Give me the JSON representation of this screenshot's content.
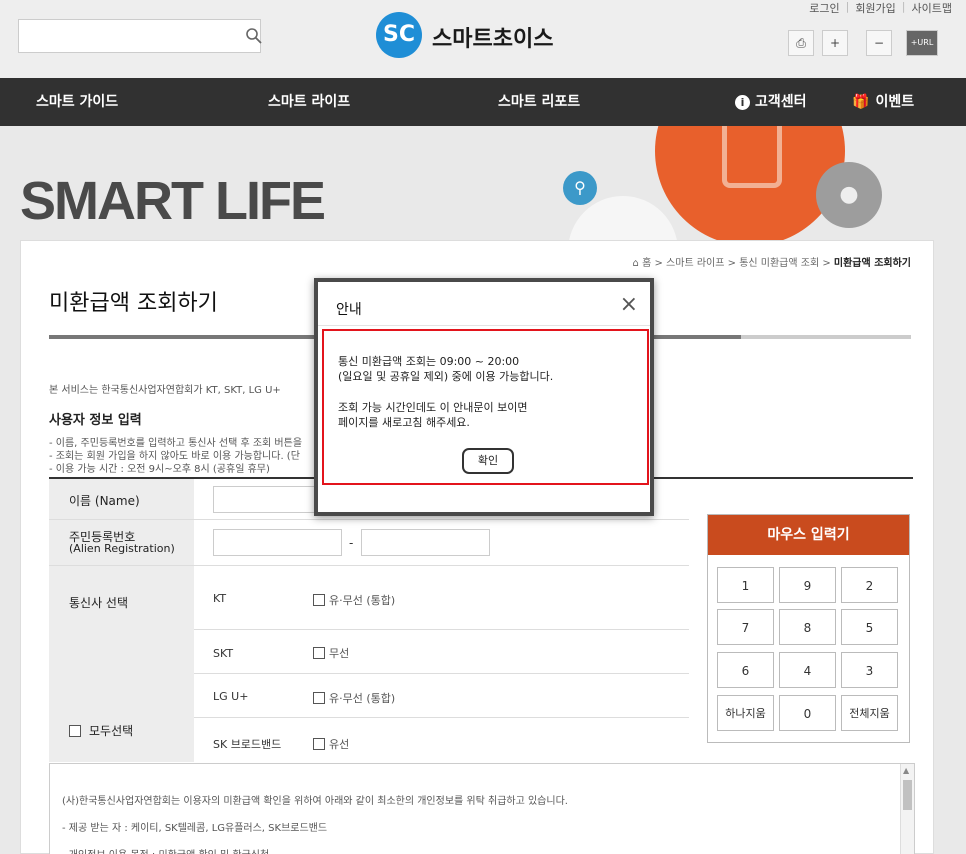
{
  "header": {
    "brand": "스마트초이스",
    "top_links": [
      "로그인",
      "회원가입",
      "사이트맵"
    ],
    "tools": [
      "print-icon",
      "zoom-in-icon",
      "zoom-out-icon",
      "url-copy-icon"
    ],
    "url_label": "+URL"
  },
  "nav": {
    "items": [
      "스마트 가이드",
      "스마트 라이프",
      "스마트 리포트"
    ],
    "support": "고객센터",
    "event": "이벤트"
  },
  "hero": {
    "title": "SMART LIFE"
  },
  "breadcrumb": {
    "home": "홈",
    "items": [
      "스마트 라이프",
      "통신 미환급액 조회"
    ],
    "current": "미환급액 조회하기"
  },
  "page": {
    "title": "미환급액 조회하기",
    "intro": "본 서비스는 한국통신사업자연합회가 KT, SKT, LG U+",
    "user_info_heading": "사용자 정보 입력",
    "notes": [
      "- 이름, 주민등록번호를 입력하고 통신사 선택 후 조회 버튼을",
      "- 조회는 회원 가입을 하지 않아도 바로 이용 가능합니다. (단",
      "- 이용 가능 시간 : 오전 9시~오후 8시 (공휴일 휴무)"
    ]
  },
  "form": {
    "name_label": "이름 (Name)",
    "rrn_label": "주민등록번호",
    "rrn_label_en": "(Alien Registration)",
    "rrn_dash": "-",
    "carrier_label": "통신사 선택",
    "select_all_label": "모두선택",
    "carriers": [
      {
        "name": "KT",
        "option": "유·무선 (통합)"
      },
      {
        "name": "SKT",
        "option": "무선"
      },
      {
        "name": "LG U+",
        "option": "유·무선 (통합)"
      },
      {
        "name": "SK 브로드밴드",
        "option": "유선"
      }
    ]
  },
  "keypad": {
    "title": "마우스 입력기",
    "keys": [
      "1",
      "9",
      "2",
      "7",
      "8",
      "5",
      "6",
      "4",
      "3"
    ],
    "backspace": "하나지움",
    "zero": "0",
    "clear": "전체지움"
  },
  "privacy": {
    "lines": [
      "(사)한국통신사업자연합회는 이용자의 미환급액 확인을 위하여 아래와 같이 최소한의 개인정보를 위탁 취급하고 있습니다.",
      "- 제공 받는 자 : 케이티, SK텔레콤, LG유플러스, SK브로드밴드",
      "- 개인정보 이용 목적 : 미환급액 확인 및 환급신청"
    ]
  },
  "modal": {
    "title": "안내",
    "line1": "통신 미환급액 조회는 09:00 ~ 20:00",
    "line2": "(일요일 및 공휴일 제외) 중에 이용 가능합니다.",
    "line3": "조회 가능 시간인데도 이 안내문이 보이면",
    "line4": "페이지를 새로고침 해주세요.",
    "ok": "확인",
    "close_symbol": "×"
  },
  "colors": {
    "nav_bg": "#313131",
    "accent_orange": "#e8602c",
    "keypad_head": "#c94b1e",
    "highlight_red": "#e3141c",
    "logo_blue": "#1f8ed6"
  }
}
